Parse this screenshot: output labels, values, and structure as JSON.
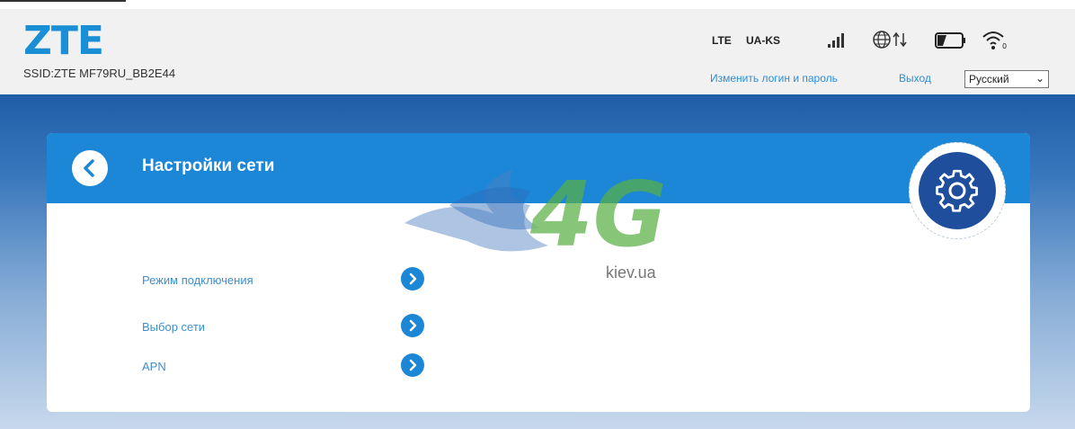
{
  "header": {
    "logo": "ZTE",
    "ssid": "SSID:ZTE MF79RU_BB2E44",
    "network_type": "LTE",
    "operator": "UA-KS",
    "change_credentials_link": "Изменить логин и пароль",
    "logout_link": "Выход",
    "language": "Русский"
  },
  "panel": {
    "title": "Настройки сети",
    "items": [
      {
        "label": "Режим подключения"
      },
      {
        "label": "Выбор сети"
      },
      {
        "label": "APN"
      }
    ]
  },
  "watermark": {
    "logo_text": "4G",
    "site": "kiev.ua"
  },
  "colors": {
    "accent": "#1b87d6",
    "brand": "#1a8fd6",
    "header_bg": "#f1f1f1",
    "gear_bg": "#1f4f9c"
  },
  "icons": [
    "signal-icon",
    "globe-icon",
    "data-transfer-icon",
    "battery-icon",
    "wifi-icon",
    "back-icon",
    "chevron-right-icon",
    "gear-icon"
  ]
}
